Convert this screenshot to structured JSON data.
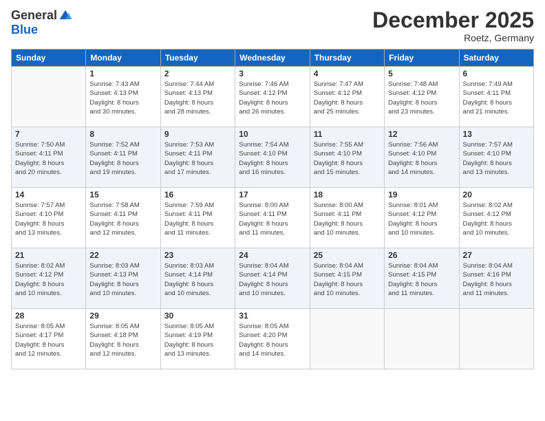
{
  "header": {
    "logo_general": "General",
    "logo_blue": "Blue",
    "month_title": "December 2025",
    "location": "Roetz, Germany"
  },
  "weekdays": [
    "Sunday",
    "Monday",
    "Tuesday",
    "Wednesday",
    "Thursday",
    "Friday",
    "Saturday"
  ],
  "weeks": [
    [
      {
        "num": "",
        "info": ""
      },
      {
        "num": "1",
        "info": "Sunrise: 7:43 AM\nSunset: 4:13 PM\nDaylight: 8 hours\nand 30 minutes."
      },
      {
        "num": "2",
        "info": "Sunrise: 7:44 AM\nSunset: 4:13 PM\nDaylight: 8 hours\nand 28 minutes."
      },
      {
        "num": "3",
        "info": "Sunrise: 7:46 AM\nSunset: 4:12 PM\nDaylight: 8 hours\nand 26 minutes."
      },
      {
        "num": "4",
        "info": "Sunrise: 7:47 AM\nSunset: 4:12 PM\nDaylight: 8 hours\nand 25 minutes."
      },
      {
        "num": "5",
        "info": "Sunrise: 7:48 AM\nSunset: 4:12 PM\nDaylight: 8 hours\nand 23 minutes."
      },
      {
        "num": "6",
        "info": "Sunrise: 7:49 AM\nSunset: 4:11 PM\nDaylight: 8 hours\nand 21 minutes."
      }
    ],
    [
      {
        "num": "7",
        "info": "Sunrise: 7:50 AM\nSunset: 4:11 PM\nDaylight: 8 hours\nand 20 minutes."
      },
      {
        "num": "8",
        "info": "Sunrise: 7:52 AM\nSunset: 4:11 PM\nDaylight: 8 hours\nand 19 minutes."
      },
      {
        "num": "9",
        "info": "Sunrise: 7:53 AM\nSunset: 4:11 PM\nDaylight: 8 hours\nand 17 minutes."
      },
      {
        "num": "10",
        "info": "Sunrise: 7:54 AM\nSunset: 4:10 PM\nDaylight: 8 hours\nand 16 minutes."
      },
      {
        "num": "11",
        "info": "Sunrise: 7:55 AM\nSunset: 4:10 PM\nDaylight: 8 hours\nand 15 minutes."
      },
      {
        "num": "12",
        "info": "Sunrise: 7:56 AM\nSunset: 4:10 PM\nDaylight: 8 hours\nand 14 minutes."
      },
      {
        "num": "13",
        "info": "Sunrise: 7:57 AM\nSunset: 4:10 PM\nDaylight: 8 hours\nand 13 minutes."
      }
    ],
    [
      {
        "num": "14",
        "info": "Sunrise: 7:57 AM\nSunset: 4:10 PM\nDaylight: 8 hours\nand 13 minutes."
      },
      {
        "num": "15",
        "info": "Sunrise: 7:58 AM\nSunset: 4:11 PM\nDaylight: 8 hours\nand 12 minutes."
      },
      {
        "num": "16",
        "info": "Sunrise: 7:59 AM\nSunset: 4:11 PM\nDaylight: 8 hours\nand 11 minutes."
      },
      {
        "num": "17",
        "info": "Sunrise: 8:00 AM\nSunset: 4:11 PM\nDaylight: 8 hours\nand 11 minutes."
      },
      {
        "num": "18",
        "info": "Sunrise: 8:00 AM\nSunset: 4:11 PM\nDaylight: 8 hours\nand 10 minutes."
      },
      {
        "num": "19",
        "info": "Sunrise: 8:01 AM\nSunset: 4:12 PM\nDaylight: 8 hours\nand 10 minutes."
      },
      {
        "num": "20",
        "info": "Sunrise: 8:02 AM\nSunset: 4:12 PM\nDaylight: 8 hours\nand 10 minutes."
      }
    ],
    [
      {
        "num": "21",
        "info": "Sunrise: 8:02 AM\nSunset: 4:12 PM\nDaylight: 8 hours\nand 10 minutes."
      },
      {
        "num": "22",
        "info": "Sunrise: 8:03 AM\nSunset: 4:13 PM\nDaylight: 8 hours\nand 10 minutes."
      },
      {
        "num": "23",
        "info": "Sunrise: 8:03 AM\nSunset: 4:14 PM\nDaylight: 8 hours\nand 10 minutes."
      },
      {
        "num": "24",
        "info": "Sunrise: 8:04 AM\nSunset: 4:14 PM\nDaylight: 8 hours\nand 10 minutes."
      },
      {
        "num": "25",
        "info": "Sunrise: 8:04 AM\nSunset: 4:15 PM\nDaylight: 8 hours\nand 10 minutes."
      },
      {
        "num": "26",
        "info": "Sunrise: 8:04 AM\nSunset: 4:15 PM\nDaylight: 8 hours\nand 11 minutes."
      },
      {
        "num": "27",
        "info": "Sunrise: 8:04 AM\nSunset: 4:16 PM\nDaylight: 8 hours\nand 11 minutes."
      }
    ],
    [
      {
        "num": "28",
        "info": "Sunrise: 8:05 AM\nSunset: 4:17 PM\nDaylight: 8 hours\nand 12 minutes."
      },
      {
        "num": "29",
        "info": "Sunrise: 8:05 AM\nSunset: 4:18 PM\nDaylight: 8 hours\nand 12 minutes."
      },
      {
        "num": "30",
        "info": "Sunrise: 8:05 AM\nSunset: 4:19 PM\nDaylight: 8 hours\nand 13 minutes."
      },
      {
        "num": "31",
        "info": "Sunrise: 8:05 AM\nSunset: 4:20 PM\nDaylight: 8 hours\nand 14 minutes."
      },
      {
        "num": "",
        "info": ""
      },
      {
        "num": "",
        "info": ""
      },
      {
        "num": "",
        "info": ""
      }
    ]
  ]
}
